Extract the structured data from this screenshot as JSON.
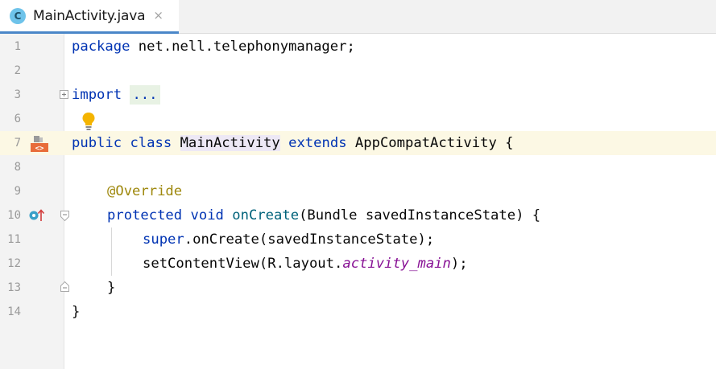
{
  "tab": {
    "icon_letter": "C",
    "title": "MainActivity.java",
    "close_glyph": "×"
  },
  "gutter": {
    "line_numbers": [
      "1",
      "2",
      "3",
      "6",
      "7",
      "8",
      "9",
      "10",
      "11",
      "12",
      "13",
      "14"
    ]
  },
  "code": {
    "line1": {
      "kw": "package",
      "rest": " net.nell.telephonymanager;"
    },
    "line3": {
      "kw": "import",
      "fold": "..."
    },
    "line7": {
      "kw1": "public",
      "kw2": "class",
      "cls": "MainActivity",
      "kw3": "extends",
      "rest": " AppCompatActivity {"
    },
    "line9": {
      "ann": "@Override"
    },
    "line10": {
      "kw1": "protected",
      "kw2": "void",
      "fn": "onCreate",
      "rest": "(Bundle savedInstanceState) {"
    },
    "line11": {
      "kw": "super",
      "rest": ".onCreate(savedInstanceState);"
    },
    "line12": {
      "pre": "setContentView(R.layout.",
      "it": "activity_main",
      "post": ");"
    },
    "line13": {
      "text": "}"
    },
    "line14": {
      "text": "}"
    }
  },
  "colors": {
    "keyword": "#0033b3",
    "annotation": "#9e880d",
    "method": "#00627a",
    "field_italic": "#871094",
    "caret_row": "#fcf8e4",
    "tab_underline": "#4a86c8"
  },
  "icons": {
    "tab": "java-class-icon",
    "tab_close": "close-icon",
    "line3": "fold-collapsed-icon",
    "line6": "lightbulb-icon",
    "line7": "run-activity-icon",
    "line10_a": "override-method-icon",
    "line10_b": "fold-expanded-icon",
    "line13": "fold-end-icon"
  }
}
